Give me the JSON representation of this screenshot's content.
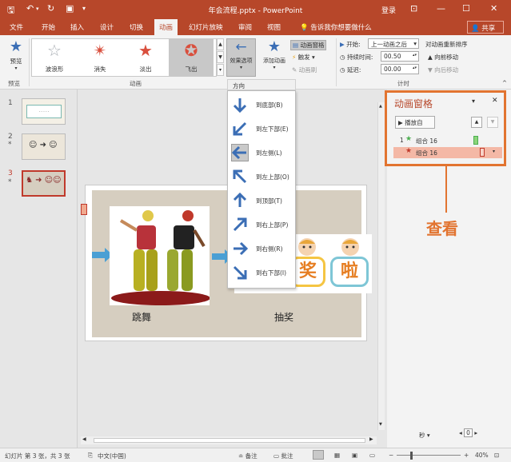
{
  "window": {
    "title": "年会流程.pptx - PowerPoint",
    "login": "登录"
  },
  "tabs": [
    "文件",
    "开始",
    "插入",
    "设计",
    "切换",
    "动画",
    "幻灯片放映",
    "审阅",
    "视图"
  ],
  "active_tab_index": 5,
  "tell_me": "告诉我你想要做什么",
  "share": "共享",
  "ribbon": {
    "preview": {
      "label": "预览",
      "group": "预览"
    },
    "gallery": {
      "items": [
        {
          "label": "波浪形",
          "icon": "star-outline-icon",
          "color": "#9aa0a6"
        },
        {
          "label": "消失",
          "icon": "star-burst-icon",
          "color": "#d94f3d"
        },
        {
          "label": "淡出",
          "icon": "star-icon",
          "color": "#d94f3d"
        },
        {
          "label": "飞出",
          "icon": "star-icon",
          "color": "#d94f3d",
          "selected": true
        }
      ],
      "group": "动画"
    },
    "effect_options": "效果选项",
    "add_animation": "添加动画",
    "animation_pane": "动画窗格",
    "trigger": "触发",
    "animation_painter": "动画刷",
    "timing": {
      "start_label": "开始:",
      "start_value": "上一动画之后",
      "duration_label": "持续时间:",
      "duration_value": "00.50",
      "delay_label": "延迟:",
      "delay_value": "00.00",
      "reorder_label": "对动画重新排序",
      "move_earlier": "向前移动",
      "move_later": "向后移动",
      "group": "计时"
    }
  },
  "direction_menu": {
    "header": "方向",
    "items": [
      {
        "label": "到底部(B)",
        "arrow": "↓",
        "selected": false
      },
      {
        "label": "到左下部(E)",
        "arrow": "↙",
        "selected": false
      },
      {
        "label": "到左侧(L)",
        "arrow": "←",
        "selected": true
      },
      {
        "label": "到左上部(O)",
        "arrow": "↖",
        "selected": false
      },
      {
        "label": "到顶部(T)",
        "arrow": "↑",
        "selected": false
      },
      {
        "label": "到右上部(P)",
        "arrow": "↗",
        "selected": false
      },
      {
        "label": "到右侧(R)",
        "arrow": "→",
        "selected": false
      },
      {
        "label": "到右下部(I)",
        "arrow": "↘",
        "selected": false
      }
    ]
  },
  "slides": [
    {
      "number": "1",
      "star": ""
    },
    {
      "number": "2",
      "star": "*"
    },
    {
      "number": "3",
      "star": "*",
      "selected": true
    }
  ],
  "slide": {
    "left_caption": "跳舞",
    "right_caption": "抽奖",
    "word1": "奖",
    "word2": "啦"
  },
  "animation_pane": {
    "title": "动画窗格",
    "play_button": "播放自",
    "items": [
      {
        "index": "1",
        "name": "组合 16",
        "color": "#4caf50"
      },
      {
        "index": "",
        "name": "组合 16",
        "color": "#d94f3d",
        "selected": true
      }
    ],
    "seconds_label": "秒",
    "zoom_value": "0"
  },
  "callout": "查看",
  "status": {
    "slide_info": "幻灯片 第 3 张，共 3 张",
    "language": "中文(中国)",
    "notes": "备注",
    "comments": "批注",
    "zoom": "40%"
  },
  "colors": {
    "accent": "#b7472a",
    "callout": "#e27430"
  }
}
